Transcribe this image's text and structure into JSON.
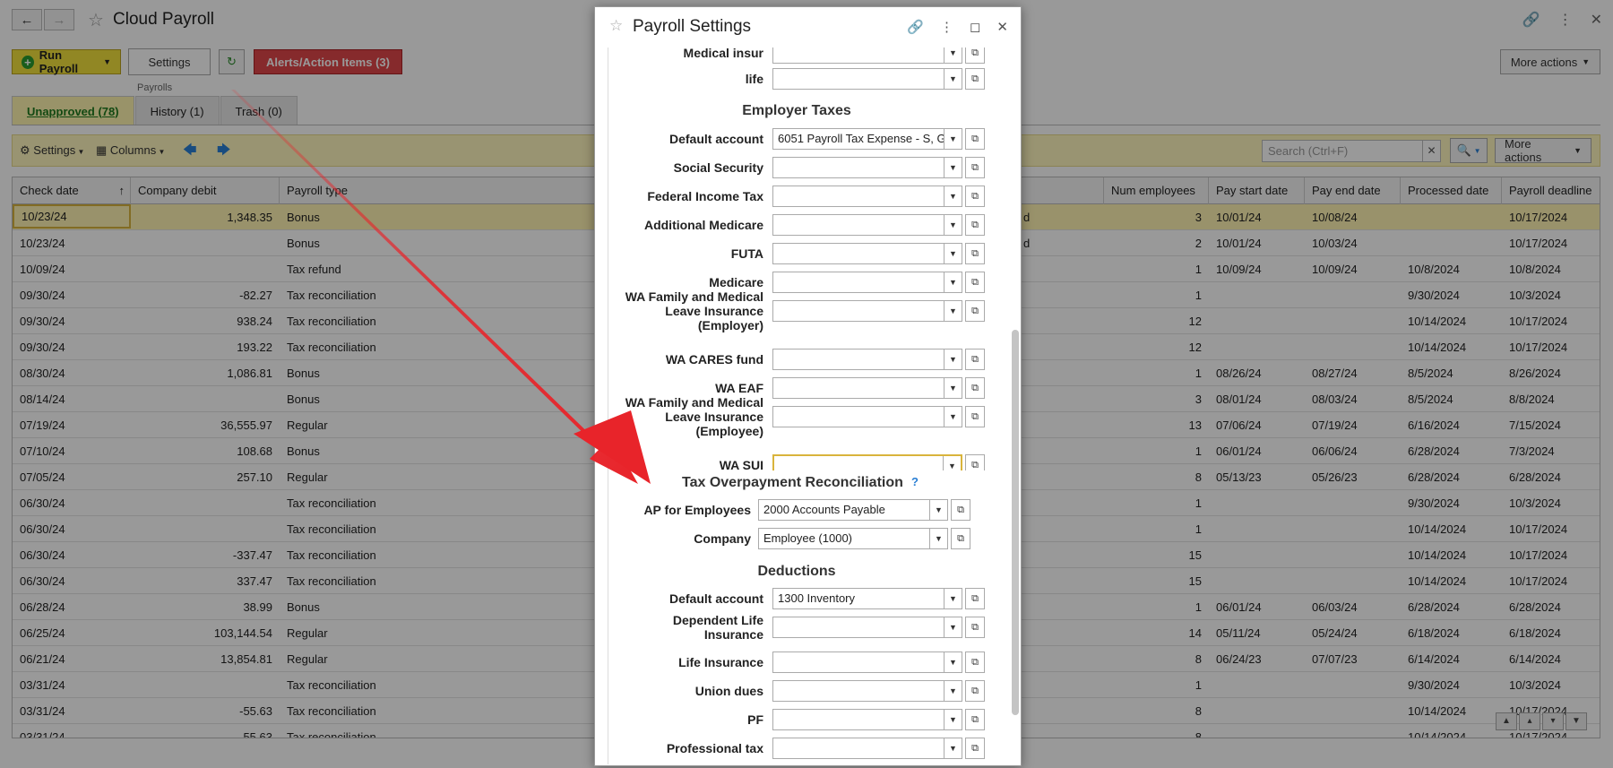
{
  "app": {
    "title": "Cloud Payroll",
    "buttons": {
      "run_payroll": "Run Payroll",
      "settings": "Settings",
      "alerts": "Alerts/Action Items (3)",
      "more_actions": "More actions"
    },
    "group_label": "Payrolls",
    "tabs": [
      {
        "label": "Unapproved (78)"
      },
      {
        "label": "History (1)"
      },
      {
        "label": "Trash (0)"
      }
    ],
    "toolbar": {
      "settings": "Settings",
      "columns": "Columns",
      "search_placeholder": "Search (Ctrl+F)",
      "more_actions": "More actions"
    }
  },
  "grid": {
    "headers": [
      "Check date",
      "Company debit",
      "Payroll type",
      "Num employees",
      "Pay start date",
      "Pay end date",
      "Processed date",
      "Payroll deadline"
    ],
    "rows": [
      {
        "check_date": "10/23/24",
        "debit": "1,348.35",
        "type": "Bonus",
        "status_tail": "d",
        "num": "3",
        "pay_start": "10/01/24",
        "pay_end": "10/08/24",
        "processed": "",
        "deadline": "10/17/2024"
      },
      {
        "check_date": "10/23/24",
        "debit": "",
        "type": "Bonus",
        "status_tail": "d",
        "num": "2",
        "pay_start": "10/01/24",
        "pay_end": "10/03/24",
        "processed": "",
        "deadline": "10/17/2024"
      },
      {
        "check_date": "10/09/24",
        "debit": "",
        "type": "Tax refund",
        "status_tail": "",
        "num": "1",
        "pay_start": "10/09/24",
        "pay_end": "10/09/24",
        "processed": "10/8/2024",
        "deadline": "10/8/2024"
      },
      {
        "check_date": "09/30/24",
        "debit": "-82.27",
        "type": "Tax reconciliation",
        "status_tail": "",
        "num": "1",
        "pay_start": "",
        "pay_end": "",
        "processed": "9/30/2024",
        "deadline": "10/3/2024"
      },
      {
        "check_date": "09/30/24",
        "debit": "938.24",
        "type": "Tax reconciliation",
        "status_tail": "",
        "num": "12",
        "pay_start": "",
        "pay_end": "",
        "processed": "10/14/2024",
        "deadline": "10/17/2024"
      },
      {
        "check_date": "09/30/24",
        "debit": "193.22",
        "type": "Tax reconciliation",
        "status_tail": "",
        "num": "12",
        "pay_start": "",
        "pay_end": "",
        "processed": "10/14/2024",
        "deadline": "10/17/2024"
      },
      {
        "check_date": "08/30/24",
        "debit": "1,086.81",
        "type": "Bonus",
        "status_tail": "",
        "num": "1",
        "pay_start": "08/26/24",
        "pay_end": "08/27/24",
        "processed": "8/5/2024",
        "deadline": "8/26/2024"
      },
      {
        "check_date": "08/14/24",
        "debit": "",
        "type": "Bonus",
        "status_tail": "",
        "num": "3",
        "pay_start": "08/01/24",
        "pay_end": "08/03/24",
        "processed": "8/5/2024",
        "deadline": "8/8/2024"
      },
      {
        "check_date": "07/19/24",
        "debit": "36,555.97",
        "type": "Regular",
        "status_tail": "",
        "num": "13",
        "pay_start": "07/06/24",
        "pay_end": "07/19/24",
        "processed": "6/16/2024",
        "deadline": "7/15/2024"
      },
      {
        "check_date": "07/10/24",
        "debit": "108.68",
        "type": "Bonus",
        "status_tail": "",
        "num": "1",
        "pay_start": "06/01/24",
        "pay_end": "06/06/24",
        "processed": "6/28/2024",
        "deadline": "7/3/2024"
      },
      {
        "check_date": "07/05/24",
        "debit": "257.10",
        "type": "Regular",
        "status_tail": "",
        "num": "8",
        "pay_start": "05/13/23",
        "pay_end": "05/26/23",
        "processed": "6/28/2024",
        "deadline": "6/28/2024"
      },
      {
        "check_date": "06/30/24",
        "debit": "",
        "type": "Tax reconciliation",
        "status_tail": "",
        "num": "1",
        "pay_start": "",
        "pay_end": "",
        "processed": "9/30/2024",
        "deadline": "10/3/2024"
      },
      {
        "check_date": "06/30/24",
        "debit": "",
        "type": "Tax reconciliation",
        "status_tail": "",
        "num": "1",
        "pay_start": "",
        "pay_end": "",
        "processed": "10/14/2024",
        "deadline": "10/17/2024"
      },
      {
        "check_date": "06/30/24",
        "debit": "-337.47",
        "type": "Tax reconciliation",
        "status_tail": "",
        "num": "15",
        "pay_start": "",
        "pay_end": "",
        "processed": "10/14/2024",
        "deadline": "10/17/2024"
      },
      {
        "check_date": "06/30/24",
        "debit": "337.47",
        "type": "Tax reconciliation",
        "status_tail": "",
        "num": "15",
        "pay_start": "",
        "pay_end": "",
        "processed": "10/14/2024",
        "deadline": "10/17/2024"
      },
      {
        "check_date": "06/28/24",
        "debit": "38.99",
        "type": "Bonus",
        "status_tail": "",
        "num": "1",
        "pay_start": "06/01/24",
        "pay_end": "06/03/24",
        "processed": "6/28/2024",
        "deadline": "6/28/2024"
      },
      {
        "check_date": "06/25/24",
        "debit": "103,144.54",
        "type": "Regular",
        "status_tail": "",
        "num": "14",
        "pay_start": "05/11/24",
        "pay_end": "05/24/24",
        "processed": "6/18/2024",
        "deadline": "6/18/2024"
      },
      {
        "check_date": "06/21/24",
        "debit": "13,854.81",
        "type": "Regular",
        "status_tail": "",
        "num": "8",
        "pay_start": "06/24/23",
        "pay_end": "07/07/23",
        "processed": "6/14/2024",
        "deadline": "6/14/2024"
      },
      {
        "check_date": "03/31/24",
        "debit": "",
        "type": "Tax reconciliation",
        "status_tail": "",
        "num": "1",
        "pay_start": "",
        "pay_end": "",
        "processed": "9/30/2024",
        "deadline": "10/3/2024"
      },
      {
        "check_date": "03/31/24",
        "debit": "-55.63",
        "type": "Tax reconciliation",
        "status_tail": "",
        "num": "8",
        "pay_start": "",
        "pay_end": "",
        "processed": "10/14/2024",
        "deadline": "10/17/2024"
      },
      {
        "check_date": "03/31/24",
        "debit": "55.63",
        "type": "Tax reconciliation",
        "status_tail": "",
        "num": "8",
        "pay_start": "",
        "pay_end": "",
        "processed": "10/14/2024",
        "deadline": "10/17/2024"
      }
    ]
  },
  "dialog": {
    "title": "Payroll Settings",
    "sections": {
      "employer_taxes": "Employer Taxes",
      "tax_overpayment": "Tax Overpayment Reconciliation",
      "deductions": "Deductions"
    },
    "help": "?",
    "fields": {
      "medical_insur": {
        "label": "Medical insur",
        "value": ""
      },
      "life": {
        "label": "life",
        "value": ""
      },
      "default_account_taxes": {
        "label": "Default account",
        "value": "6051 Payroll Tax Expense - S, G &"
      },
      "social_security": {
        "label": "Social Security",
        "value": ""
      },
      "federal_income_tax": {
        "label": "Federal Income Tax",
        "value": ""
      },
      "additional_medicare": {
        "label": "Additional Medicare",
        "value": ""
      },
      "futa": {
        "label": "FUTA",
        "value": ""
      },
      "medicare": {
        "label": "Medicare",
        "value": ""
      },
      "wa_fmli_employer": {
        "label": "WA Family and Medical Leave Insurance (Employer)",
        "value": ""
      },
      "wa_cares": {
        "label": "WA CARES fund",
        "value": ""
      },
      "wa_eaf": {
        "label": "WA EAF",
        "value": ""
      },
      "wa_fmli_employee": {
        "label": "WA Family and Medical Leave Insurance (Employee)",
        "value": ""
      },
      "wa_sui": {
        "label": "WA SUI",
        "value": ""
      },
      "ap_employees": {
        "label": "AP for Employees",
        "value": "2000 Accounts Payable"
      },
      "company": {
        "label": "Company",
        "value": "Employee (1000)"
      },
      "default_account_ded": {
        "label": "Default account",
        "value": "1300 Inventory"
      },
      "dependent_life": {
        "label": "Dependent Life Insurance",
        "value": ""
      },
      "life_insurance": {
        "label": "Life Insurance",
        "value": ""
      },
      "union_dues": {
        "label": "Union dues",
        "value": ""
      },
      "pf": {
        "label": "PF",
        "value": ""
      },
      "professional_tax": {
        "label": "Professional tax",
        "value": ""
      }
    }
  },
  "colors": {
    "accent_yellow": "#f2e23c",
    "alert_red": "#e0474a",
    "arrow_red": "#e8242a"
  }
}
